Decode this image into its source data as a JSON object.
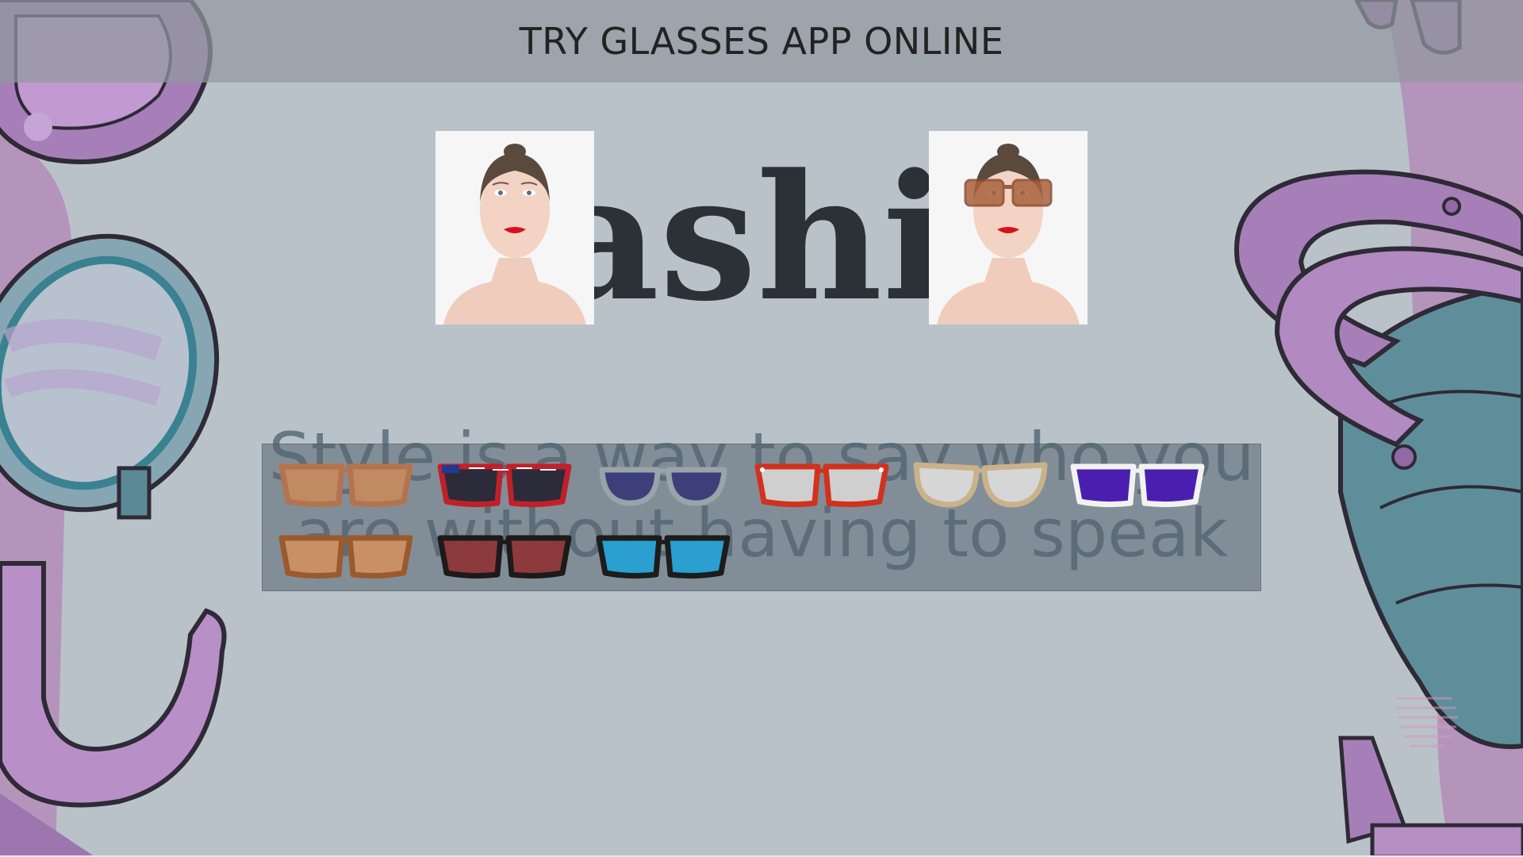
{
  "header": {
    "title": "TRY GLASSES APP ONLINE"
  },
  "background": {
    "headline_fragment": "ashio",
    "quote": "Style is a way to say who you are without having to speak"
  },
  "photos": [
    {
      "id": "before",
      "glasses": null
    },
    {
      "id": "after",
      "glasses": "brown-transparent"
    }
  ],
  "glasses": [
    {
      "name": "brown-wayfarer",
      "frame": "#b4734f",
      "lens": "#c08a63"
    },
    {
      "name": "usa-flag-sunglasses",
      "frame": "#c0202a",
      "lens": "#2b2b3a"
    },
    {
      "name": "navy-aviator",
      "frame": "#9aa2aa",
      "lens": "#3d3f7a"
    },
    {
      "name": "red-star-frame",
      "frame": "#d0321e",
      "lens": "#cfcfcf"
    },
    {
      "name": "gold-cat-eye",
      "frame": "#c9b28a",
      "lens": "#d6d6d6"
    },
    {
      "name": "white-purple-lens",
      "frame": "#f2f2f2",
      "lens": "#4a1fb0"
    },
    {
      "name": "tortoise-brown",
      "frame": "#9a5a2e",
      "lens": "#c99066"
    },
    {
      "name": "black-red-mirror",
      "frame": "#1e1a1a",
      "lens": "#8c3a3e"
    },
    {
      "name": "black-blue-lens",
      "frame": "#1c1c1c",
      "lens": "#2a9fd0"
    }
  ],
  "colors": {
    "background": "#b9c2c9",
    "header_bg": "#9aa1a7",
    "panel_bg": "#6e7b84",
    "decor_purple": "#b58fc4",
    "decor_teal": "#5f8e9b"
  }
}
